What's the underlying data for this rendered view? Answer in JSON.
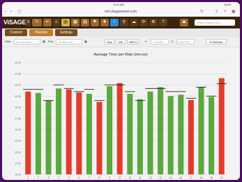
{
  "status": {
    "time": "8:10 AM",
    "battery": "100%"
  },
  "browser": {
    "url": "m3.visagesmart.com",
    "reload_icon": "reload-icon",
    "share_icon": "share-icon"
  },
  "app": {
    "logo": "ViSAGE",
    "search_placeholder": "Search history, ALL..."
  },
  "tabs": [
    {
      "label": "Content"
    },
    {
      "label": "Playlists"
    },
    {
      "label": "Settings"
    }
  ],
  "filters": {
    "start_label": "Start",
    "start_value": "01-Nov-2017",
    "end_label": "End",
    "end_value": "10-Nov-2017",
    "range_buttons": [
      "Day",
      "Wk",
      "MNTH"
    ],
    "time_start": "7:00 AM",
    "time_end": "6:00 PM",
    "refresh_label": "Refresh"
  },
  "colors": {
    "green": "#5aa83e",
    "red": "#e23b2c",
    "target_line": "#222222"
  },
  "chart_data": {
    "type": "bar",
    "title": "Average Time per Ride (mm:ss)",
    "categories": [
      "1",
      "2",
      "3",
      "4",
      "5",
      "6",
      "7",
      "8",
      "9",
      "10",
      "11",
      "12",
      "13",
      "14",
      "15",
      "16",
      "17",
      "18",
      "19",
      "20"
    ],
    "values": [
      33.5,
      33.2,
      31.5,
      34.2,
      34.0,
      33.3,
      33.0,
      31.2,
      34.7,
      35.4,
      33.0,
      31.8,
      33.5,
      34.5,
      32.5,
      32.8,
      31.6,
      34.5,
      32.3,
      36.5
    ],
    "targets": [
      34.0,
      34.0,
      31.5,
      35.0,
      34.2,
      33.5,
      34.0,
      31.5,
      35.0,
      35.0,
      33.5,
      31.5,
      34.2,
      34.2,
      33.5,
      33.5,
      32.0,
      34.5,
      32.5,
      35.3
    ],
    "bar_colors": [
      "red",
      "green",
      "green",
      "green",
      "red",
      "red",
      "green",
      "red",
      "green",
      "red",
      "green",
      "green",
      "green",
      "green",
      "green",
      "green",
      "red",
      "green",
      "green",
      "red"
    ],
    "ylim": [
      15,
      40
    ],
    "yticks": [
      "15.00",
      "17.50",
      "20.00",
      "22.50",
      "25.00",
      "27.50",
      "30.00",
      "32.50",
      "35.00",
      "37.50",
      "40.00"
    ],
    "xlabel": "",
    "ylabel": ""
  }
}
